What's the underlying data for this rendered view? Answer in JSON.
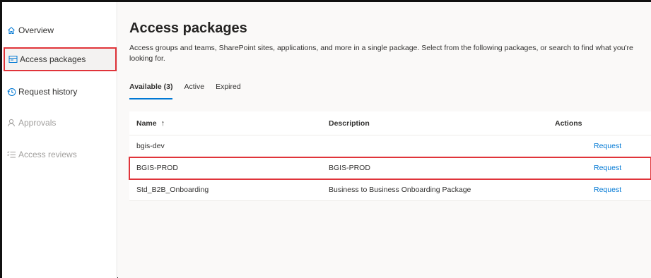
{
  "sidebar": {
    "items": [
      {
        "label": "Overview",
        "icon": "home-icon",
        "state": "normal"
      },
      {
        "label": "Access packages",
        "icon": "package-icon",
        "state": "selected"
      },
      {
        "label": "Request history",
        "icon": "history-icon",
        "state": "normal"
      },
      {
        "label": "Approvals",
        "icon": "person-icon",
        "state": "disabled"
      },
      {
        "label": "Access reviews",
        "icon": "checklist-icon",
        "state": "disabled"
      }
    ]
  },
  "main": {
    "title": "Access packages",
    "description": "Access groups and teams, SharePoint sites, applications, and more in a single package. Select from the following packages, or search to find what you're looking for.",
    "tabs": [
      {
        "label": "Available (3)",
        "active": true
      },
      {
        "label": "Active",
        "active": false
      },
      {
        "label": "Expired",
        "active": false
      }
    ],
    "table": {
      "columns": [
        "Name",
        "Description",
        "Actions"
      ],
      "sort_indicator": "↑",
      "rows": [
        {
          "name": "bgis-dev",
          "description": "",
          "action": "Request",
          "highlighted": false
        },
        {
          "name": "BGIS-PROD",
          "description": "BGIS-PROD",
          "action": "Request",
          "highlighted": true
        },
        {
          "name": "Std_B2B_Onboarding",
          "description": "Business to Business Onboarding Package",
          "action": "Request",
          "highlighted": false
        }
      ]
    }
  },
  "colors": {
    "accent": "#0078d4",
    "highlight": "#e0343a",
    "disabled": "#a19f9d"
  }
}
